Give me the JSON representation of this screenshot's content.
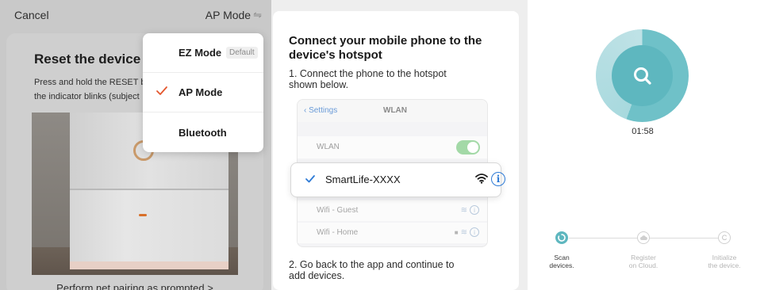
{
  "panel1": {
    "cancel_label": "Cancel",
    "mode_label": "AP Mode",
    "mode_icon": "switch-arrows-icon",
    "title": "Reset the device fi",
    "desc_line1": "Press and hold the RESET b",
    "desc_line2": "the indicator blinks (subject",
    "bottom_link": "Perform net pairing as prompted >",
    "dropdown": {
      "items": [
        {
          "label": "EZ Mode",
          "badge": "Default",
          "selected": false
        },
        {
          "label": "AP Mode",
          "badge": "",
          "selected": true
        },
        {
          "label": "Bluetooth",
          "badge": "",
          "selected": false
        }
      ],
      "check_color": "#e4572e"
    }
  },
  "panel2": {
    "title_line1": "Connect your mobile phone to the",
    "title_line2": "device's hotspot",
    "step1_line1": "1. Connect the phone to the hotspot",
    "step1_line2": "shown below.",
    "ios": {
      "back_label": "Settings",
      "nav_title": "WLAN",
      "wlan_label": "WLAN",
      "wlan_on": true,
      "networks": [
        {
          "name": "Wifi - Guest",
          "locked": false
        },
        {
          "name": "Wifi - Home",
          "locked": true
        }
      ]
    },
    "hotspot": {
      "name": "SmartLife-XXXX",
      "info_glyph": "i"
    },
    "step2_line1": "2. Go back to the app and continue to",
    "step2_line2": "add devices."
  },
  "panel3": {
    "timer": "01:58",
    "accent_color": "#5eb7bf",
    "steps": [
      {
        "line1": "Scan",
        "line2": "devices.",
        "active": true
      },
      {
        "line1": "Register",
        "line2": "on Cloud.",
        "active": false
      },
      {
        "line1": "Initialize",
        "line2": "the device.",
        "active": false
      }
    ]
  }
}
